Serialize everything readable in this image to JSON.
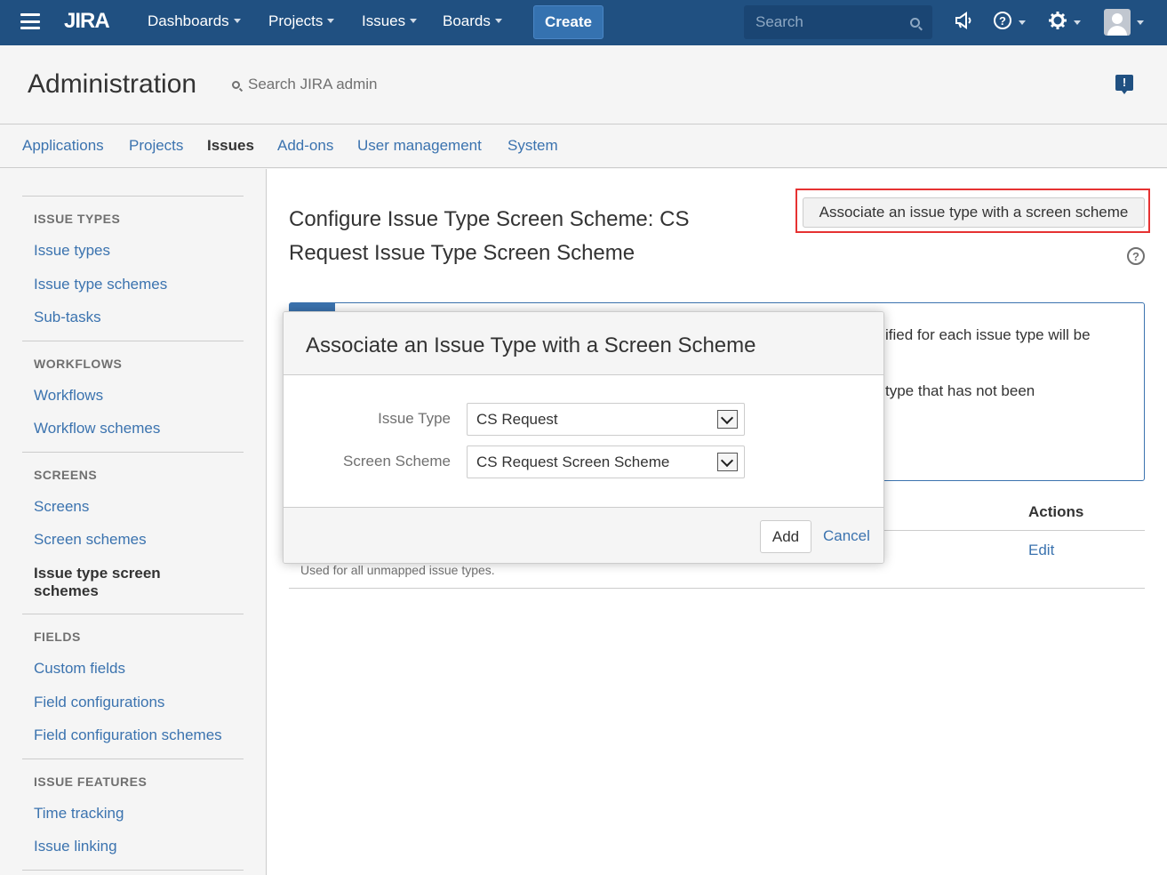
{
  "topnav": {
    "logo": "JIRA",
    "items": [
      "Dashboards",
      "Projects",
      "Issues",
      "Boards"
    ],
    "create_label": "Create",
    "search_placeholder": "Search"
  },
  "admin_header": {
    "title": "Administration",
    "search_placeholder": "Search JIRA admin",
    "feedback_label": "!"
  },
  "tabs": [
    "Applications",
    "Projects",
    "Issues",
    "Add-ons",
    "User management",
    "System"
  ],
  "active_tab": "Issues",
  "sidebar": {
    "sections": [
      {
        "heading": "ISSUE TYPES",
        "items": [
          "Issue types",
          "Issue type schemes",
          "Sub-tasks"
        ]
      },
      {
        "heading": "WORKFLOWS",
        "items": [
          "Workflows",
          "Workflow schemes"
        ]
      },
      {
        "heading": "SCREENS",
        "items": [
          "Screens",
          "Screen schemes",
          "Issue type screen schemes"
        ]
      },
      {
        "heading": "FIELDS",
        "items": [
          "Custom fields",
          "Field configurations",
          "Field configuration schemes"
        ]
      },
      {
        "heading": "ISSUE FEATURES",
        "items": [
          "Time tracking",
          "Issue linking"
        ]
      }
    ],
    "current_item": "Issue type screen schemes"
  },
  "main": {
    "page_title": "Configure Issue Type Screen Scheme: CS Request Issue Type Screen Scheme",
    "associate_button": "Associate an issue type with a screen scheme",
    "help_label": "?",
    "info_line1": "ified for each issue type will be",
    "info_line2": "type that has not been",
    "table": {
      "actions_header": "Actions",
      "edit_label": "Edit",
      "default_description": "Used for all unmapped issue types."
    }
  },
  "dialog": {
    "title": "Associate an Issue Type with a Screen Scheme",
    "fields": [
      {
        "label": "Issue Type",
        "value": "CS Request"
      },
      {
        "label": "Screen Scheme",
        "value": "CS Request Screen Scheme"
      }
    ],
    "add_label": "Add",
    "cancel_label": "Cancel"
  },
  "colors": {
    "nav_bg": "#205081",
    "link": "#3b73af",
    "highlight": "#e63232"
  }
}
